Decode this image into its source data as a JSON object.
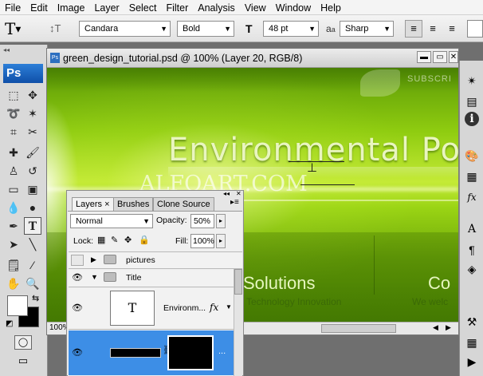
{
  "menu": [
    "File",
    "Edit",
    "Image",
    "Layer",
    "Select",
    "Filter",
    "Analysis",
    "View",
    "Window",
    "Help"
  ],
  "options": {
    "font_family": "Candara",
    "font_style": "Bold",
    "font_size": "48 pt",
    "aa_label": "a",
    "aa_label2": "a",
    "anti_alias": "Sharp",
    "size_icon_label": "T"
  },
  "toolbar": {
    "logo": "Ps"
  },
  "document": {
    "title": "green_design_tutorial.psd @ 100% (Layer 20, RGB/8)",
    "zoom": "100%",
    "canvas": {
      "subscribe": "SUBSCRI",
      "heading": "Environmental Po",
      "watermark": "ALFOART.COM",
      "col1_title": "Solutions",
      "col1_sub": "Technology Innovation",
      "col2_title": "Co",
      "col2_sub": "We welc"
    }
  },
  "layers_panel": {
    "tabs": [
      "Layers",
      "Brushes",
      "Clone Source"
    ],
    "tab_close": "×",
    "blend_mode": "Normal",
    "opacity_label": "Opacity:",
    "opacity": "50%",
    "lock_label": "Lock:",
    "fill_label": "Fill:",
    "fill": "100%",
    "rows": [
      {
        "name": "pictures",
        "visible": false,
        "type": "group",
        "expanded": false
      },
      {
        "name": "Title",
        "visible": true,
        "type": "group",
        "expanded": true
      },
      {
        "name": "Environm...",
        "visible": true,
        "type": "text",
        "thumb": "T",
        "fx": "fx"
      },
      {
        "name": "",
        "visible": true,
        "type": "pixel",
        "selected": true,
        "more": "..."
      }
    ]
  },
  "colors": {
    "selection": "#3d8ee6",
    "green_dark": "#4f8a04",
    "green_light": "#c4ea36"
  }
}
